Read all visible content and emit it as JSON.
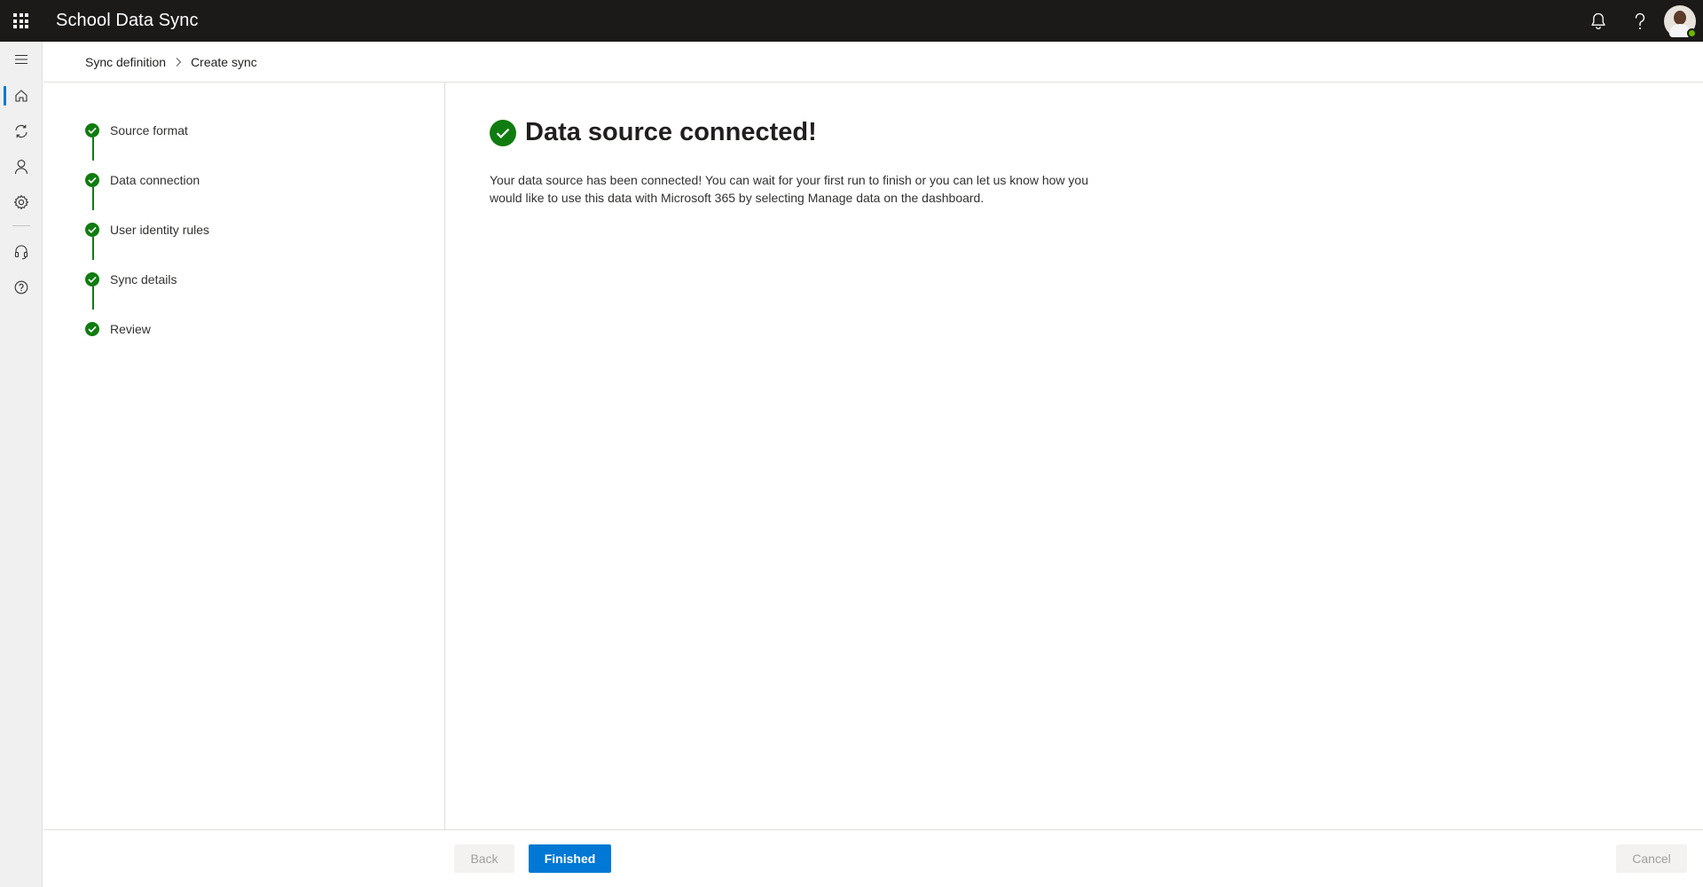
{
  "app": {
    "title": "School Data Sync"
  },
  "header": {
    "icons": [
      "waffle-icon",
      "bell-icon",
      "help-icon",
      "avatar"
    ],
    "presence_color": "#6bb700"
  },
  "rail": {
    "items": [
      "menu-icon",
      "home-icon",
      "sync-icon",
      "person-icon",
      "settings-icon",
      "headset-icon",
      "help-circle-icon"
    ],
    "active": "home-icon",
    "accent": "#0078d4"
  },
  "breadcrumb": {
    "items": [
      "Sync definition",
      "Create sync"
    ]
  },
  "steps": [
    {
      "label": "Source format",
      "status": "complete"
    },
    {
      "label": "Data connection",
      "status": "complete"
    },
    {
      "label": "User identity rules",
      "status": "complete"
    },
    {
      "label": "Sync details",
      "status": "complete"
    },
    {
      "label": "Review",
      "status": "complete"
    }
  ],
  "main": {
    "title": "Data source connected!",
    "description_line1": "Your data source has been connected! You can wait for your first run to finish or you can let us know how you",
    "description_line2": "would like to use this data with Microsoft 365 by selecting Manage data on the dashboard."
  },
  "footer": {
    "back_label": "Back",
    "finished_label": "Finished",
    "cancel_label": "Cancel"
  },
  "colors": {
    "success": "#107c10",
    "primary": "#0078d4",
    "topbar": "#1b1a19"
  }
}
